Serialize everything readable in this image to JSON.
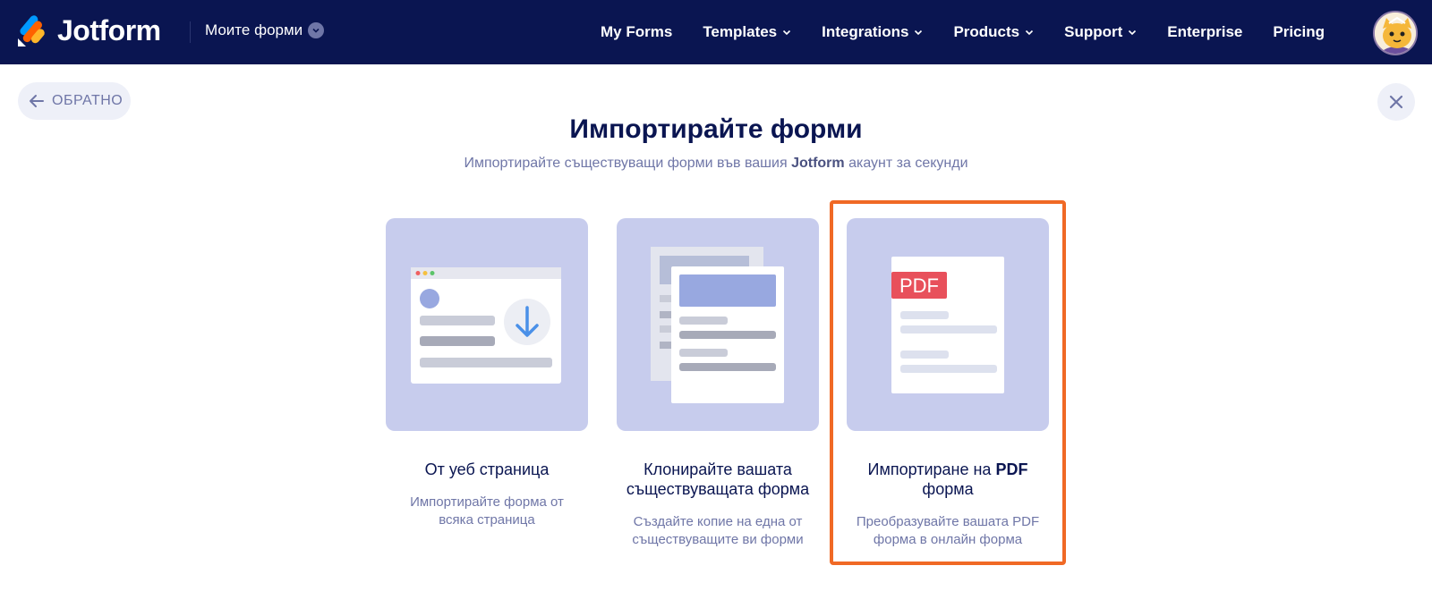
{
  "nav": {
    "logo_text": "Jotform",
    "my_forms_dropdown": "Моите форми",
    "links": [
      "My Forms",
      "Templates",
      "Integrations",
      "Products",
      "Support",
      "Enterprise",
      "Pricing"
    ]
  },
  "back_label": "ОБРАТНО",
  "title": "Импортирайте форми",
  "subtitle_before": "Импортирайте съществуващи форми във вашия ",
  "subtitle_brand": "Jotform",
  "subtitle_after": " акаунт за секунди",
  "cards": [
    {
      "title": "От уеб страница",
      "description": "Импортирайте форма от всяка страница"
    },
    {
      "title": "Клонирайте вашата съществуващата форма",
      "description": "Създайте копие на една от съществуващите ви форми"
    },
    {
      "title_before": "Импортиране на ",
      "title_bold": "PDF",
      "title_after": " форма",
      "description": "Преобразувайте вашата PDF форма в онлайн форма",
      "art_badge": "PDF",
      "selected": true
    }
  ],
  "colors": {
    "navbar": "#0a1551",
    "card_bg": "#c7cced",
    "selected_border": "#f06925",
    "muted_text": "#6f76a7",
    "pdf_badge": "#e8505b"
  }
}
